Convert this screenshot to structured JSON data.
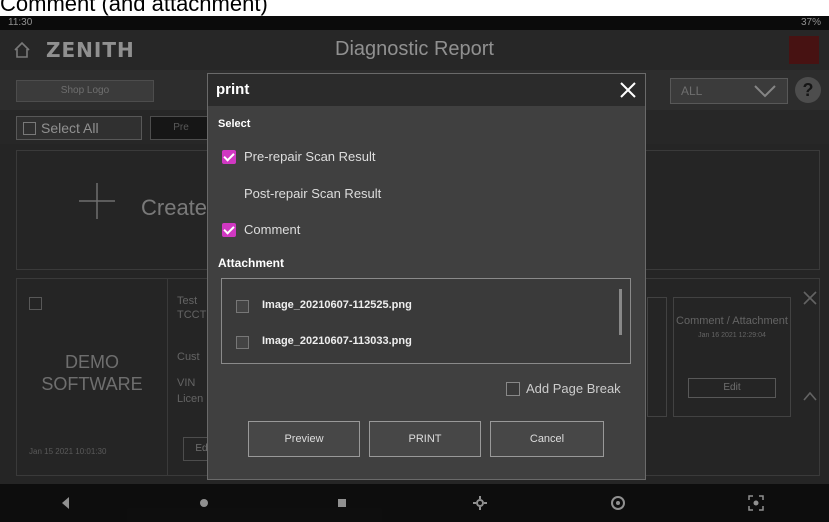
{
  "caption": "Comment (and attachment)",
  "status_bar": {
    "time": "11:30",
    "right": "37%"
  },
  "app": {
    "logo": "ZENITH",
    "title": "Diagnostic Report"
  },
  "toolbar": {
    "shop_logo": "Shop Logo",
    "filter_value": "ALL",
    "help": "?"
  },
  "list": {
    "select_all": "Select All",
    "pre_button": "Pre"
  },
  "create_card": {
    "label": "Create"
  },
  "report_card": {
    "name": "DEMO SOFTWARE",
    "date": "Jan 15 2021 10:01:30",
    "field_1": "Test",
    "field_2": "TCCT",
    "field_3": "Cust",
    "field_4": "VIN",
    "field_5": "Licen",
    "edit_left": "Edit",
    "comment_title": "Comment / Attachment",
    "comment_date": "Jan 16 2021 12:29:04",
    "comment_edit": "Edit"
  },
  "dialog": {
    "title": "print",
    "select_label": "Select",
    "options": [
      {
        "label": "Pre-repair Scan Result",
        "checked": true
      },
      {
        "label": "Post-repair Scan Result",
        "checked": false
      },
      {
        "label": "Comment",
        "checked": true
      }
    ],
    "attachment_label": "Attachment",
    "attachments": [
      "Image_20210607-112525.png",
      "Image_20210607-113033.png"
    ],
    "page_break": "Add Page Break",
    "buttons": {
      "preview": "Preview",
      "print": "PRINT",
      "cancel": "Cancel"
    }
  },
  "colors": {
    "accent": "#d038c2",
    "background": "#3a3a3a",
    "dialog": "#404040"
  }
}
